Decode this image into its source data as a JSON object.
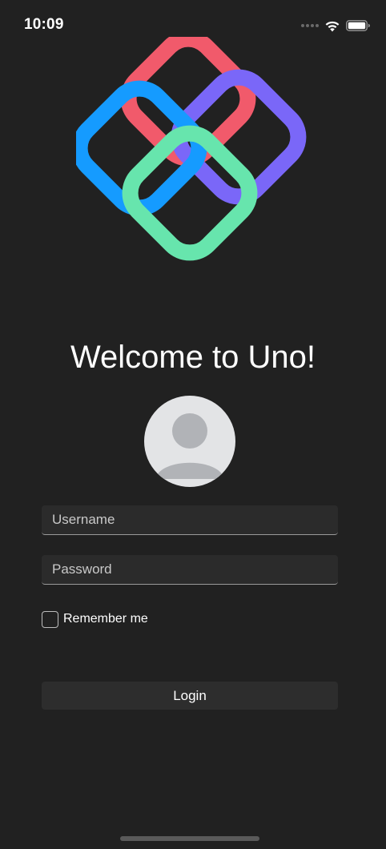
{
  "status_bar": {
    "time": "10:09",
    "icons": [
      "signal-dots-icon",
      "wifi-icon",
      "battery-icon"
    ]
  },
  "logo": {
    "icon": "uno-platform-logo",
    "colors": {
      "red": "#f15a6b",
      "purple": "#7a67f8",
      "blue": "#159bff",
      "green": "#67e5ad"
    }
  },
  "welcome": {
    "title": "Welcome to Uno!"
  },
  "avatar": {
    "icon": "user-avatar-icon"
  },
  "form": {
    "username_placeholder": "Username",
    "password_placeholder": "Password",
    "remember_label": "Remember me",
    "remember_checked": false,
    "login_label": "Login"
  },
  "theme": {
    "background": "#212121",
    "field_background": "#2b2b2b"
  }
}
